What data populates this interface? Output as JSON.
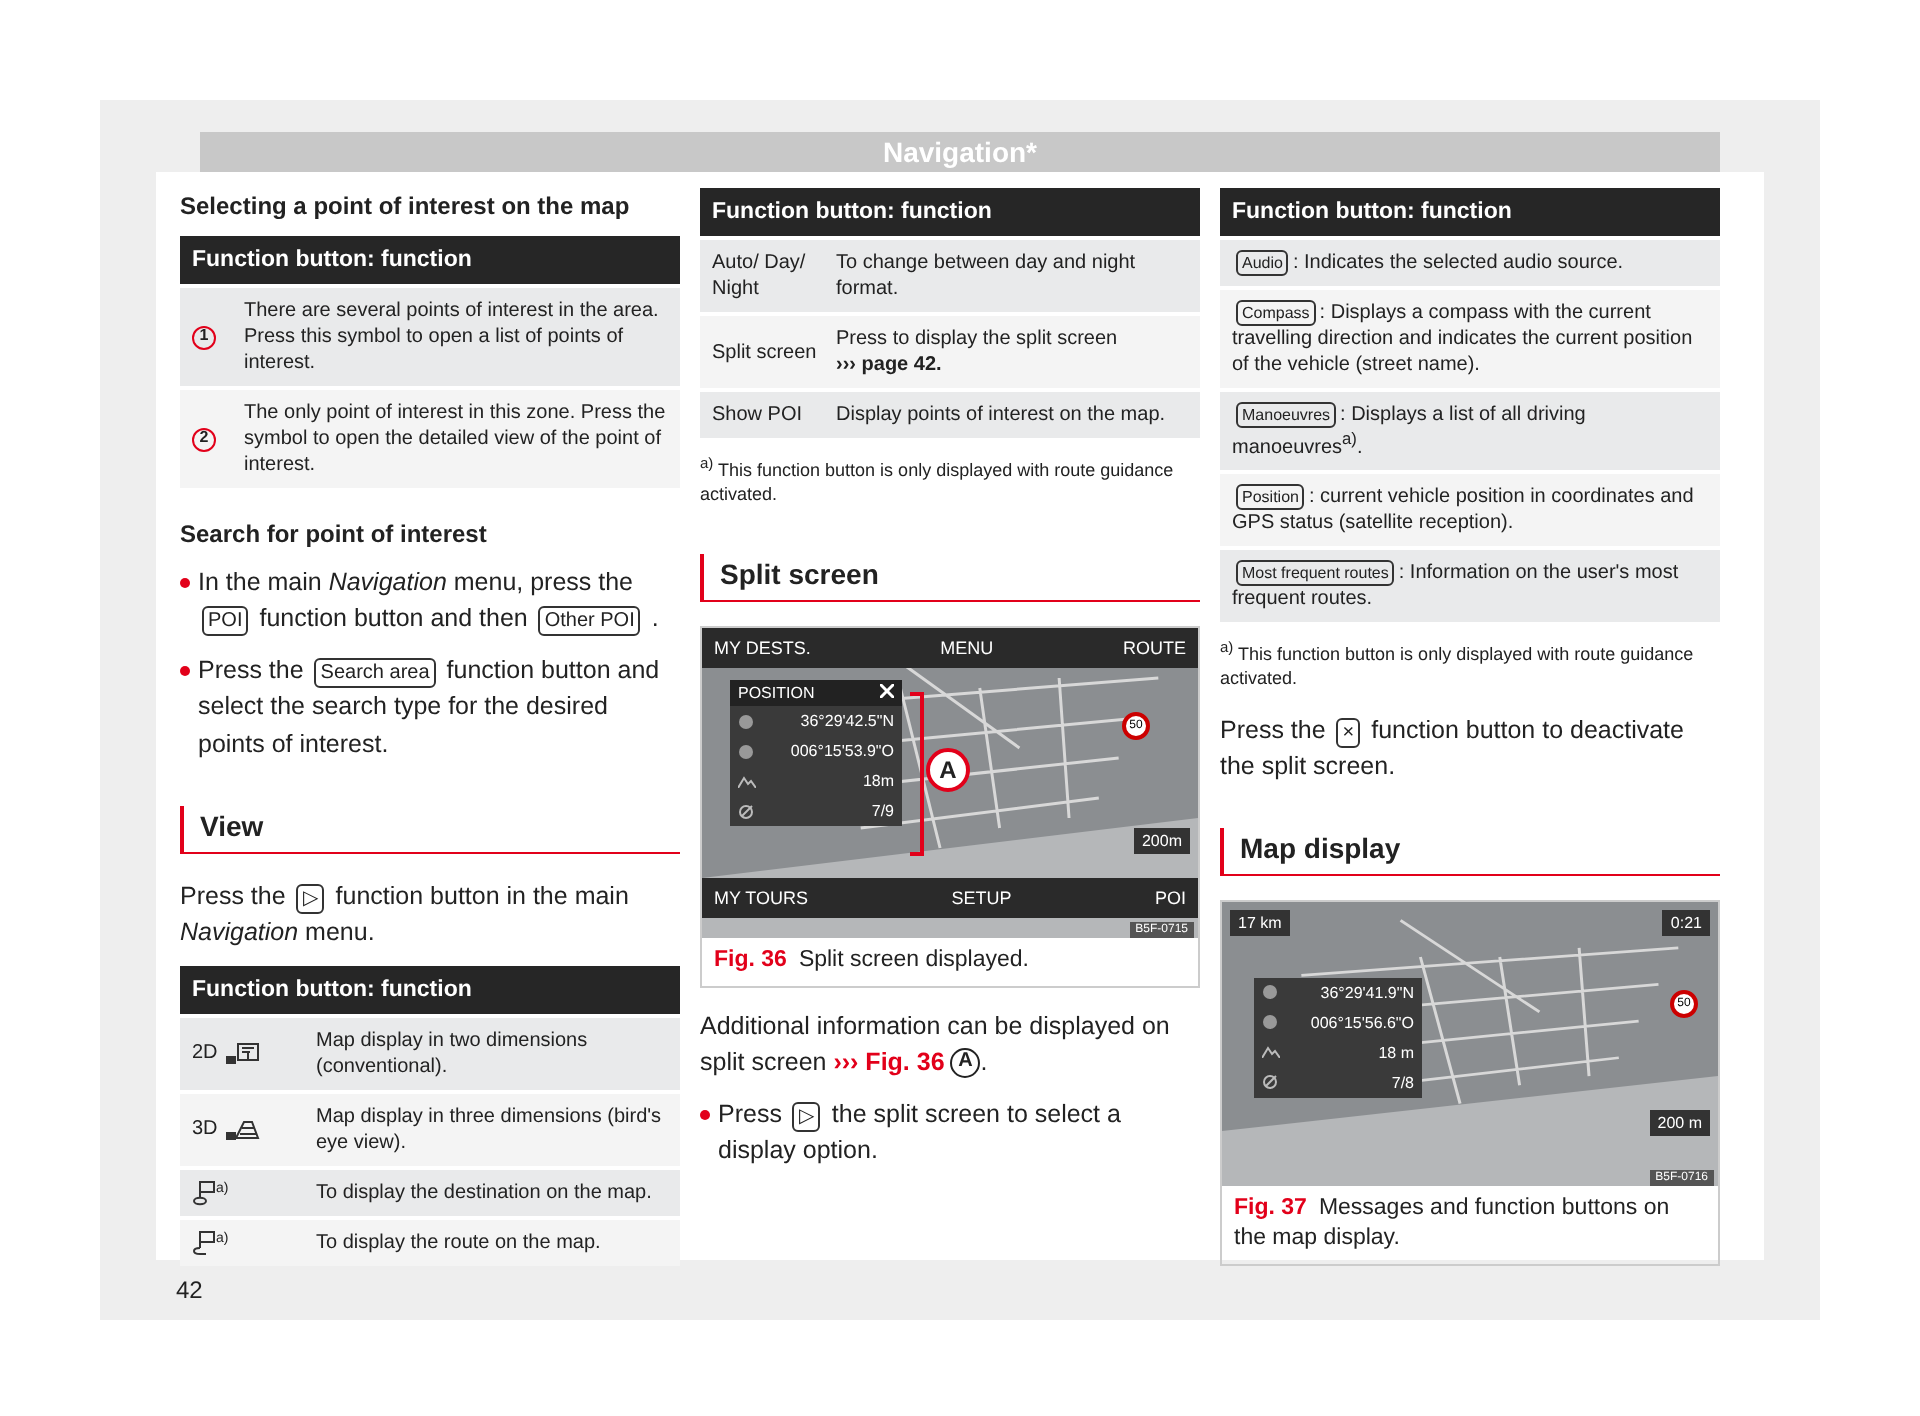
{
  "header": {
    "title": "Navigation*"
  },
  "columns": [
    {
      "blocks": [
        {
          "kind": "subheading",
          "text": "Selecting a point of interest on the map"
        },
        {
          "kind": "table",
          "header": "Function button: function",
          "rows": [
            {
              "cell": {
                "kind": "callout",
                "text": "1"
              },
              "text": "There are several points of interest in the area. Press this symbol to open a list of points of interest."
            },
            {
              "cell": {
                "kind": "callout",
                "text": "2"
              },
              "text": "The only point of interest in this zone. Press the symbol to open the detailed view of the point of interest."
            }
          ]
        },
        {
          "kind": "subheading",
          "text": "Search for point of interest"
        },
        {
          "kind": "bullet",
          "parts": [
            {
              "kind": "text",
              "text": "In the main *Navigation* menu, press the"
            },
            {
              "kind": "key",
              "text": "POI"
            },
            {
              "kind": "text",
              "text": "function button and then"
            },
            {
              "kind": "key",
              "text": "Other POI"
            },
            {
              "kind": "text",
              "text": "."
            }
          ]
        },
        {
          "kind": "bullet",
          "parts": [
            {
              "kind": "text",
              "text": "Press the"
            },
            {
              "kind": "key",
              "text": "Search area"
            },
            {
              "kind": "text",
              "text": "function button and select the search type for the desired points of interest."
            }
          ]
        },
        {
          "kind": "section",
          "text": "View"
        },
        {
          "kind": "paragraph",
          "parts": [
            {
              "kind": "text",
              "text": "Press the"
            },
            {
              "kind": "key",
              "text": "▷"
            },
            {
              "kind": "text",
              "text": "function button in the main *Navigation* menu."
            }
          ]
        },
        {
          "kind": "table",
          "header": "Function button: function",
          "rows": [
            {
              "cell": {
                "kind": "mode-2d",
                "text": "2D"
              },
              "text": "Map display in two dimensions (conventional)."
            },
            {
              "cell": {
                "kind": "mode-3d",
                "text": "3D"
              },
              "text": "Map display in three dimensions (bird's eye view)."
            },
            {
              "cell": {
                "kind": "destination-flag",
                "text": "a)"
              },
              "text": "To display the destination on the map."
            },
            {
              "cell": {
                "kind": "route-flag",
                "text": "a)"
              },
              "text": "To display the route on the map."
            }
          ]
        }
      ]
    },
    {
      "blocks": [
        {
          "kind": "table",
          "header": "Function button: function",
          "rows": [
            {
              "cell": {
                "kind": "label",
                "text": "Auto/ Day/ Night"
              },
              "text": "To change between day and night format."
            },
            {
              "cell": {
                "kind": "label",
                "text": "Split screen"
              },
              "text": "Press to display the split screen\n**››› page 42.**"
            },
            {
              "cell": {
                "kind": "label",
                "text": "Show POI"
              },
              "text": "Display points of interest on the map."
            }
          ]
        },
        {
          "kind": "footnote",
          "text": "$^{a)}$ This function button is only displayed with route guidance activated."
        },
        {
          "kind": "section",
          "text": "Split screen"
        },
        {
          "kind": "figure",
          "label": "Fig. 36",
          "caption": "Split screen displayed.",
          "screen": {
            "kind": "split",
            "top_tabs": [
              "MY DESTS.",
              "MENU",
              "ROUTE"
            ],
            "bottom_tabs": [
              "MY TOURS",
              "SETUP",
              "POI"
            ],
            "panel_title": "POSITION",
            "panel_rows": [
              {
                "kind": "globe",
                "value": "36°29'42.5\"N"
              },
              {
                "kind": "globe",
                "value": "006°15'53.9\"O"
              },
              {
                "kind": "altitude",
                "value": "18m"
              },
              {
                "kind": "satellite",
                "value": "7/9"
              }
            ],
            "callout": "A",
            "speed_limit": "50",
            "scale": "200m",
            "code": "B5F-0715"
          }
        },
        {
          "kind": "paragraph",
          "parts": [
            {
              "kind": "text",
              "text": "Additional information can be displayed on split screen"
            },
            {
              "kind": "ref",
              "text": "››› Fig. 36"
            },
            {
              "kind": "callout",
              "text": "A"
            },
            {
              "kind": "text",
              "text": "."
            }
          ]
        },
        {
          "kind": "bullet",
          "parts": [
            {
              "kind": "text",
              "text": "Press"
            },
            {
              "kind": "key",
              "text": "▷"
            },
            {
              "kind": "text",
              "text": "the split screen to select a display option."
            }
          ]
        }
      ]
    },
    {
      "blocks": [
        {
          "kind": "keytable",
          "header": "Function button: function",
          "rows": [
            {
              "key": "Audio",
              "text": ": Indicates the selected audio source."
            },
            {
              "key": "Compass",
              "text": ": Displays a compass with the current travelling direction and indicates the current position of the vehicle (street name)."
            },
            {
              "key": "Manoeuvres",
              "text": ": Displays a list of all driving manoeuvres$^{a)}$."
            },
            {
              "key": "Position",
              "text": ": current vehicle position in coordinates and GPS status (satellite reception)."
            },
            {
              "key": "Most frequent routes",
              "text": ": Information on the user's most frequent routes."
            }
          ]
        },
        {
          "kind": "footnote",
          "text": "$^{a)}$ This function button is only displayed with route guidance activated."
        },
        {
          "kind": "paragraph",
          "parts": [
            {
              "kind": "text",
              "text": "Press the"
            },
            {
              "kind": "key",
              "text": "×"
            },
            {
              "kind": "text",
              "text": "function button to deactivate the split screen."
            }
          ]
        },
        {
          "kind": "section",
          "text": "Map display"
        },
        {
          "kind": "figure",
          "label": "Fig. 37",
          "caption": "Messages and function buttons on the map display.",
          "screen": {
            "kind": "map",
            "distance": "17 km",
            "time": "0:21",
            "panel_rows": [
              {
                "kind": "globe",
                "value": "36°29'41.9\"N"
              },
              {
                "kind": "globe",
                "value": "006°15'56.6\"O"
              },
              {
                "kind": "altitude",
                "value": "18 m"
              },
              {
                "kind": "satellite",
                "value": "7/8"
              }
            ],
            "speed_limit": "50",
            "scale": "200 m",
            "code": "B5F-0716"
          }
        }
      ]
    }
  ],
  "page_number": "42"
}
